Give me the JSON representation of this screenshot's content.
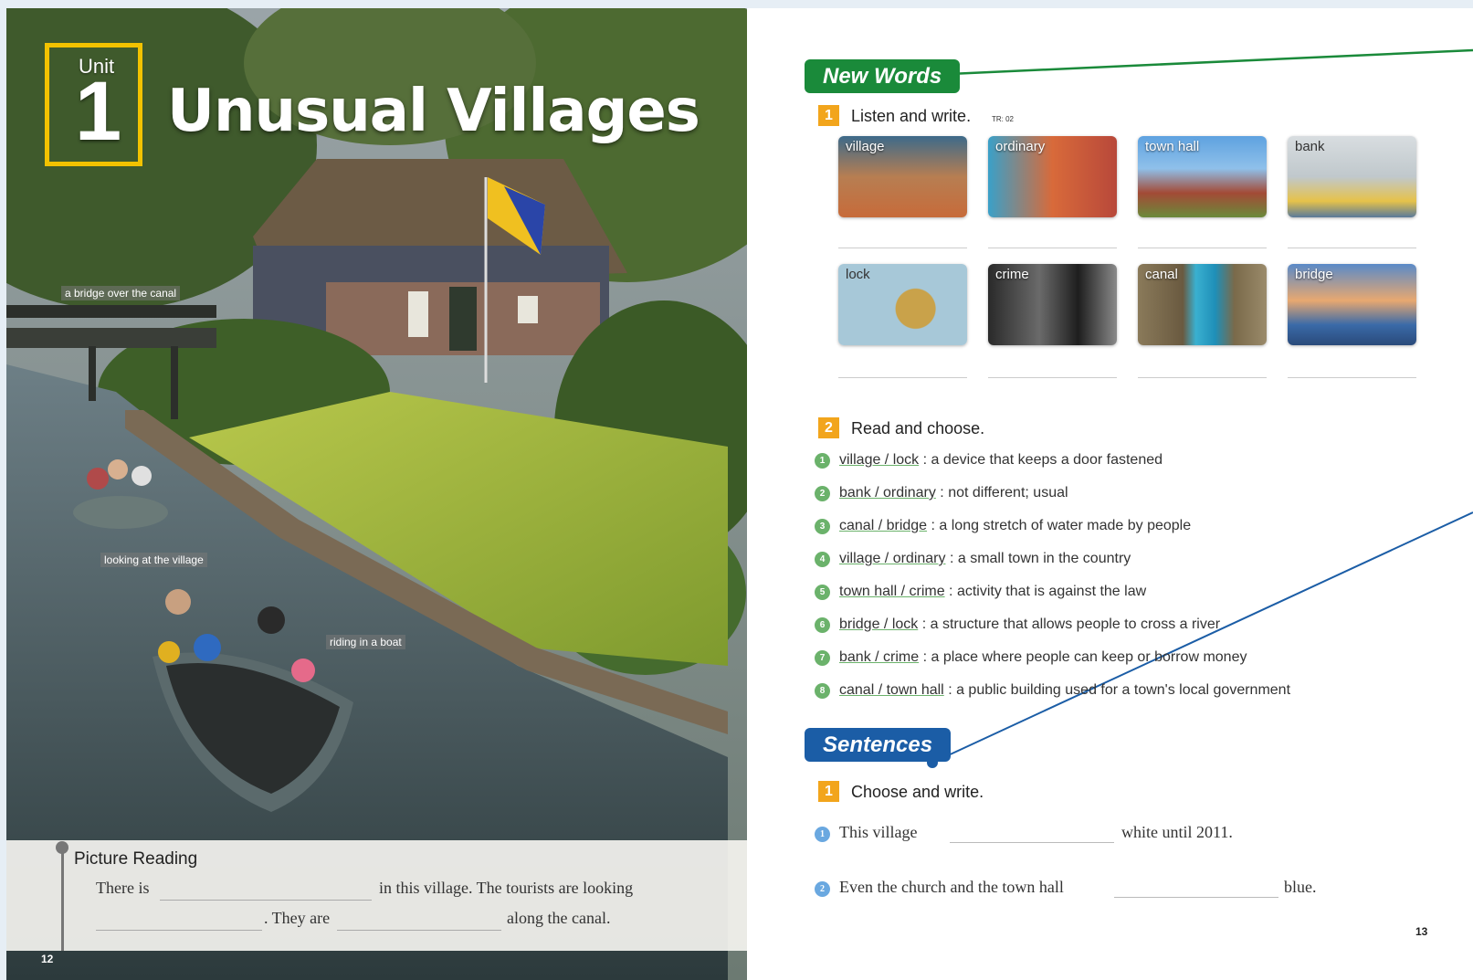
{
  "left_page": {
    "unit_label": "Unit",
    "unit_number": "1",
    "title": "Unusual Villages",
    "photo_labels": [
      "a bridge over the canal",
      "looking at the village",
      "riding in a boat"
    ],
    "picture_reading": {
      "title": "Picture Reading",
      "line1_a": "There is",
      "line1_b": "in this village. The tourists are looking",
      "line2_a": ". They are",
      "line2_b": "along the canal."
    },
    "page_number": "12"
  },
  "right_page": {
    "new_words_header": "New Words",
    "task1": {
      "number": "1",
      "title": "Listen and write.",
      "track": "TR: 02"
    },
    "word_images": [
      {
        "label": "village",
        "icon": "village-photo"
      },
      {
        "label": "ordinary",
        "icon": "houses-photo"
      },
      {
        "label": "town hall",
        "icon": "building-photo"
      },
      {
        "label": "bank",
        "icon": "bank-photo"
      },
      {
        "label": "lock",
        "icon": "padlock-photo"
      },
      {
        "label": "crime",
        "icon": "thief-photo"
      },
      {
        "label": "canal",
        "icon": "canal-photo"
      },
      {
        "label": "bridge",
        "icon": "bridge-photo"
      }
    ],
    "task2": {
      "number": "2",
      "title": "Read and choose."
    },
    "definitions": [
      {
        "choice": "village / lock",
        "text": ":  a device that keeps a door fastened"
      },
      {
        "choice": "bank / ordinary",
        "text": ":  not different; usual"
      },
      {
        "choice": "canal / bridge",
        "text": ":  a long stretch of water made by people"
      },
      {
        "choice": "village / ordinary",
        "text": ":  a small town in the country"
      },
      {
        "choice": "town hall / crime",
        "text": ":  activity that is against the law"
      },
      {
        "choice": "bridge / lock",
        "text": ":  a structure that allows people to cross a river"
      },
      {
        "choice": "bank / crime",
        "text": ":  a place where people can keep or borrow money"
      },
      {
        "choice": "canal / town hall",
        "text": ":  a public building used for a town's local government"
      }
    ],
    "sentences_header": "Sentences",
    "task3": {
      "number": "1",
      "title": "Choose and write."
    },
    "sentences": [
      {
        "before": "This village",
        "after": "white until 2011."
      },
      {
        "before": "Even the church and the town hall",
        "after": "blue."
      }
    ],
    "page_number": "13"
  },
  "colors": {
    "green": "#1a8a3a",
    "blue": "#1b5da6",
    "orange": "#f2a51c",
    "unit_yellow": "#f2c200"
  }
}
